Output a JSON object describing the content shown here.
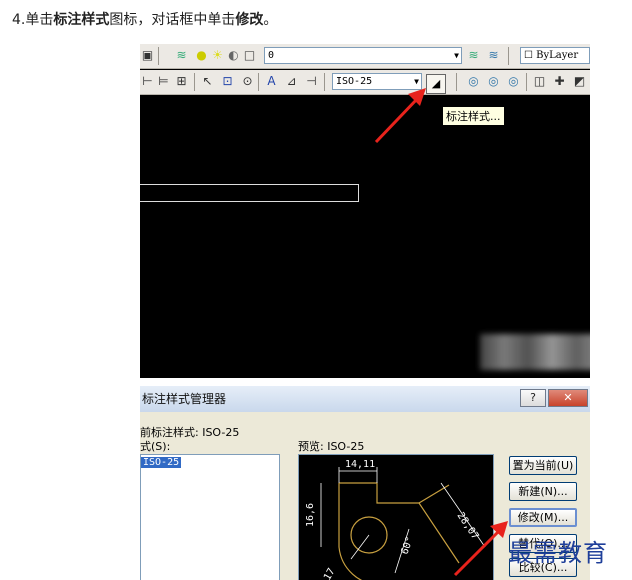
{
  "instruction": {
    "prefix": "4.单击",
    "bold1": "标注样式",
    "middle": "图标，对话框中单击",
    "bold2": "修改",
    "suffix": "。"
  },
  "toolbar_top": {
    "layer_combo": "0",
    "color_combo": "ByLayer"
  },
  "toolbar_dim": {
    "style_combo": "ISO-25",
    "tooltip": "标注样式..."
  },
  "dialog": {
    "title": "标注样式管理器",
    "help_button": "?",
    "close_button": "✕",
    "current_style_label": "前标注样式: ISO-25",
    "styles_label": "式(S):",
    "list_items": [
      "ISO-25"
    ],
    "preview_label": "预览: ISO-25",
    "preview_dims": {
      "top": "14,11",
      "left": "16,6",
      "diag": "28,07",
      "angle": "60°",
      "bottom": "17"
    },
    "buttons": {
      "set_current": "置为当前(U)",
      "new": "新建(N)...",
      "modify": "修改(M)...",
      "override": "替代(O)...",
      "compare": "比较(C)..."
    }
  },
  "watermark": "最需教育",
  "colors": {
    "arrow": "#e8231c",
    "preview_line": "#c8a040",
    "tooltip_bg": "#ffffe1"
  }
}
